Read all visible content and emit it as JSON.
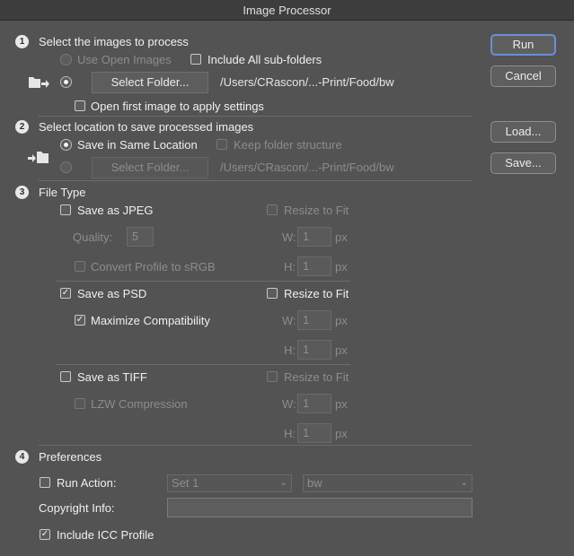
{
  "window": {
    "title": "Image Processor"
  },
  "section1": {
    "num": "1",
    "title": "Select the images to process",
    "use_open_images": "Use Open Images",
    "include_subfolders": "Include All sub-folders",
    "select_folder_btn": "Select Folder...",
    "folder_path": "/Users/CRascon/...-Print/Food/bw",
    "open_first": "Open first image to apply settings"
  },
  "section2": {
    "num": "2",
    "title": "Select location to save processed images",
    "save_same": "Save in Same Location",
    "keep_structure": "Keep folder structure",
    "select_folder_btn": "Select Folder...",
    "folder_path": "/Users/CRascon/...-Print/Food/bw"
  },
  "section3": {
    "num": "3",
    "title": "File Type",
    "jpeg": {
      "label": "Save as JPEG",
      "resize": "Resize to Fit",
      "quality_label": "Quality:",
      "quality_value": "5",
      "w_label": "W:",
      "w_value": "1",
      "px": "px",
      "convert": "Convert Profile to sRGB",
      "h_label": "H:",
      "h_value": "1"
    },
    "psd": {
      "label": "Save as PSD",
      "resize": "Resize to Fit",
      "maximize": "Maximize Compatibility",
      "w_label": "W:",
      "w_value": "1",
      "px": "px",
      "h_label": "H:",
      "h_value": "1"
    },
    "tiff": {
      "label": "Save as TIFF",
      "resize": "Resize to Fit",
      "lzw": "LZW Compression",
      "w_label": "W:",
      "w_value": "1",
      "px": "px",
      "h_label": "H:",
      "h_value": "1"
    }
  },
  "section4": {
    "num": "4",
    "title": "Preferences",
    "run_action": "Run Action:",
    "set_value": "Set 1",
    "action_value": "bw",
    "copyright_label": "Copyright Info:",
    "copyright_value": "",
    "include_icc": "Include ICC Profile"
  },
  "buttons": {
    "run": "Run",
    "cancel": "Cancel",
    "load": "Load...",
    "save": "Save..."
  },
  "glyphs": {
    "check": "✓",
    "arrow": "⌄"
  },
  "icons": [
    "folder-arrow-icon",
    "folder-save-icon"
  ]
}
